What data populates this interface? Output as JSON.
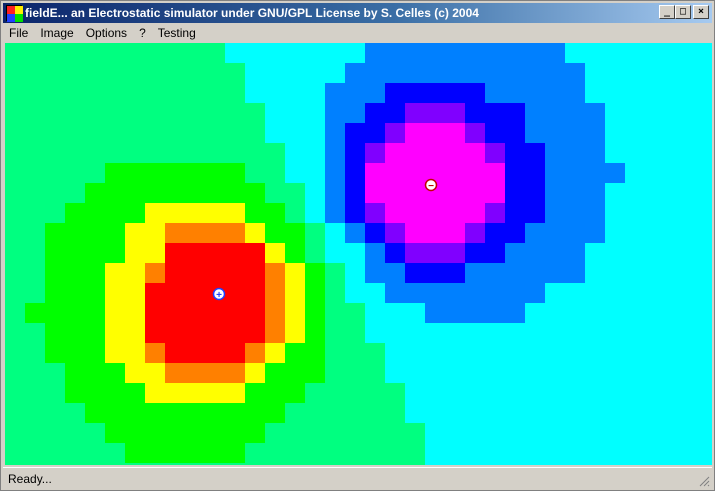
{
  "window": {
    "title": "fieldE... an Electrostatic simulator under GNU/GPL License by S. Celles (c) 2004",
    "minimize_glyph": "_",
    "maximize_glyph": "□",
    "close_glyph": "×"
  },
  "menu": {
    "items": [
      {
        "label": "File"
      },
      {
        "label": "Image"
      },
      {
        "label": "Options"
      },
      {
        "label": "?"
      },
      {
        "label": "Testing"
      }
    ]
  },
  "simulation": {
    "background_color": "#00ffff",
    "charges": [
      {
        "sign": "positive",
        "symbol": "+",
        "marker_color": "#2040ff"
      },
      {
        "sign": "negative",
        "symbol": "−",
        "marker_color": "#c00000"
      }
    ],
    "potential_palette": {
      "positive": [
        "#00ff80",
        "#00ff00",
        "#ffff00",
        "#ff8000",
        "#ff0000"
      ],
      "negative": [
        "#0080ff",
        "#0000ff",
        "#8000ff",
        "#ff00ff"
      ]
    }
  },
  "status": {
    "text": "Ready..."
  }
}
